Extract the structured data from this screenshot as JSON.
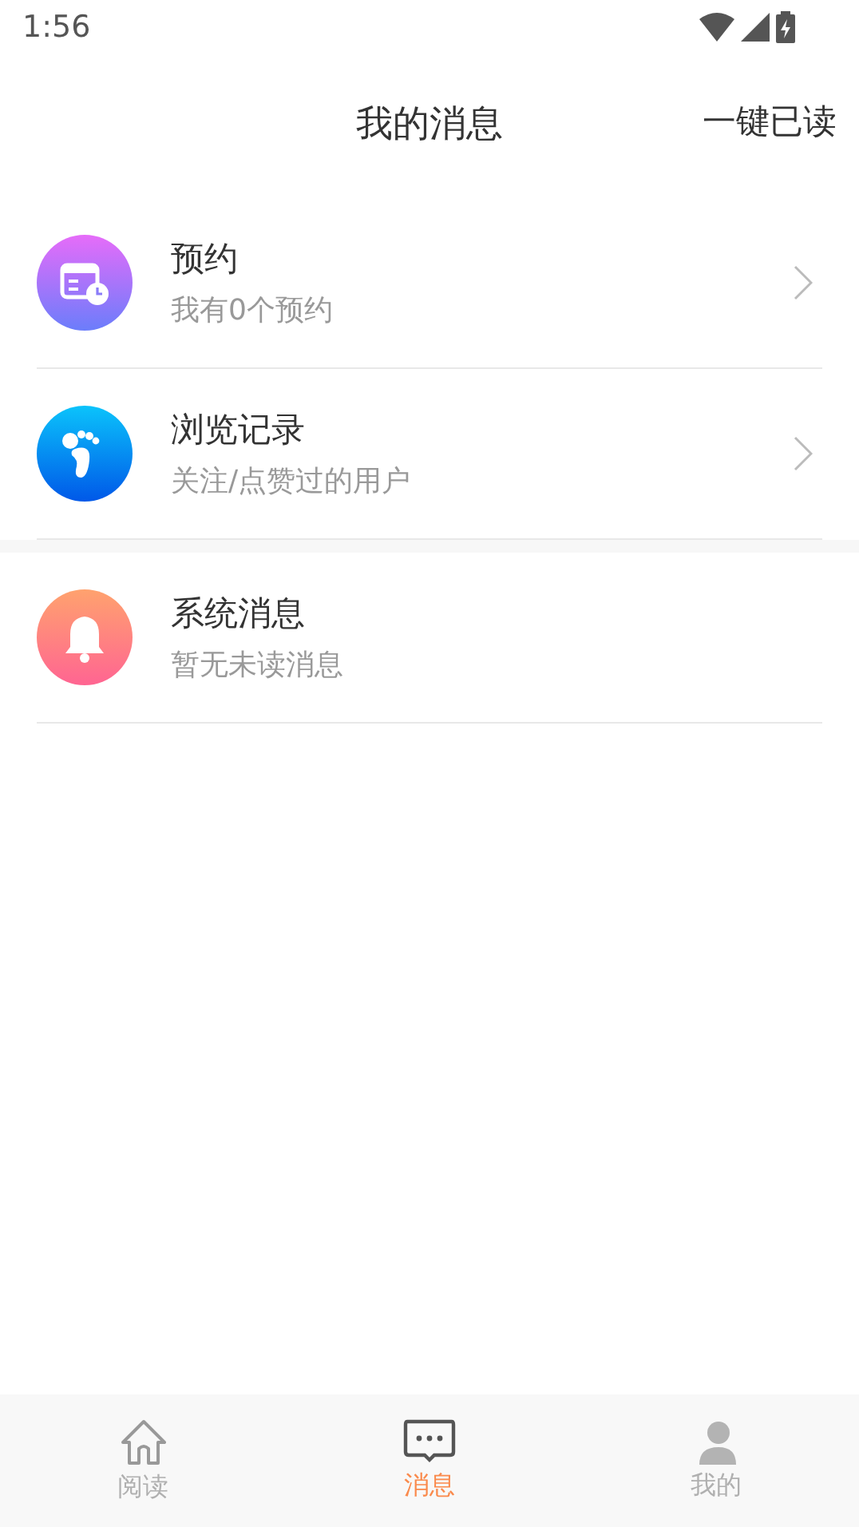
{
  "status_bar": {
    "time": "1:56"
  },
  "header": {
    "title": "我的消息",
    "action": "一键已读"
  },
  "groups": [
    {
      "items": [
        {
          "kind": "booking",
          "title": "预约",
          "subtitle": "我有0个预约",
          "chevron": true
        },
        {
          "kind": "history",
          "title": "浏览记录",
          "subtitle": "关注/点赞过的用户",
          "chevron": true
        }
      ]
    },
    {
      "items": [
        {
          "kind": "system",
          "title": "系统消息",
          "subtitle": "暂无未读消息",
          "chevron": false
        }
      ]
    }
  ],
  "tabs": [
    {
      "kind": "home",
      "label": "阅读",
      "selected": false
    },
    {
      "kind": "messages",
      "label": "消息",
      "selected": true
    },
    {
      "kind": "profile",
      "label": "我的",
      "selected": false
    }
  ]
}
